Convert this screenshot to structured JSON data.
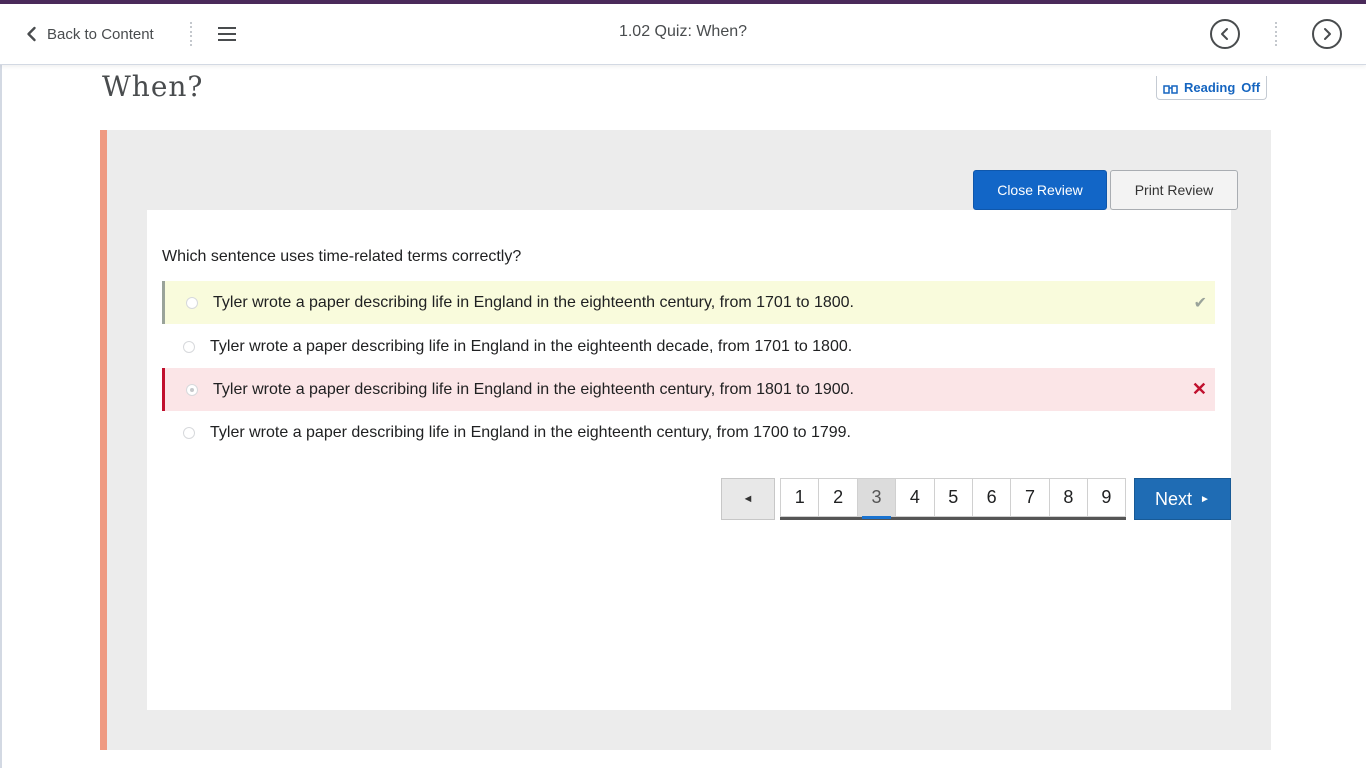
{
  "header": {
    "back_label": "Back to Content",
    "title": "1.02 Quiz: When?"
  },
  "page": {
    "heading": "When?",
    "reading": {
      "label": "Reading",
      "state": "Off"
    }
  },
  "review": {
    "close_label": "Close Review",
    "print_label": "Print Review"
  },
  "question": {
    "text": "Which sentence uses time-related terms correctly?",
    "options": [
      {
        "text": "Tyler wrote a paper describing life in England in the eighteenth century, from 1701 to 1800.",
        "status": "correct",
        "mark": "✔"
      },
      {
        "text": "Tyler wrote a paper describing life in England in the eighteenth decade, from 1701 to 1800.",
        "status": "none",
        "mark": ""
      },
      {
        "text": "Tyler wrote a paper describing life in England in the eighteenth century, from 1801 to 1900.",
        "status": "incorrect",
        "mark": "✕"
      },
      {
        "text": "Tyler wrote a paper describing life in England in the eighteenth century, from 1700 to 1799.",
        "status": "none",
        "mark": ""
      }
    ]
  },
  "pagination": {
    "prev_symbol": "◄",
    "pages": [
      "1",
      "2",
      "3",
      "4",
      "5",
      "6",
      "7",
      "8",
      "9"
    ],
    "current": "3",
    "next_label": "Next",
    "next_symbol": "►"
  },
  "colors": {
    "accent": "#1266c7",
    "top_border": "#4a2a5a",
    "left_stripe": "#ef9a82",
    "correct_bg": "#f9fbdc",
    "incorrect_bg": "#fbe5e7",
    "incorrect_mark": "#c0102e",
    "correct_mark": "#9aa39a"
  }
}
